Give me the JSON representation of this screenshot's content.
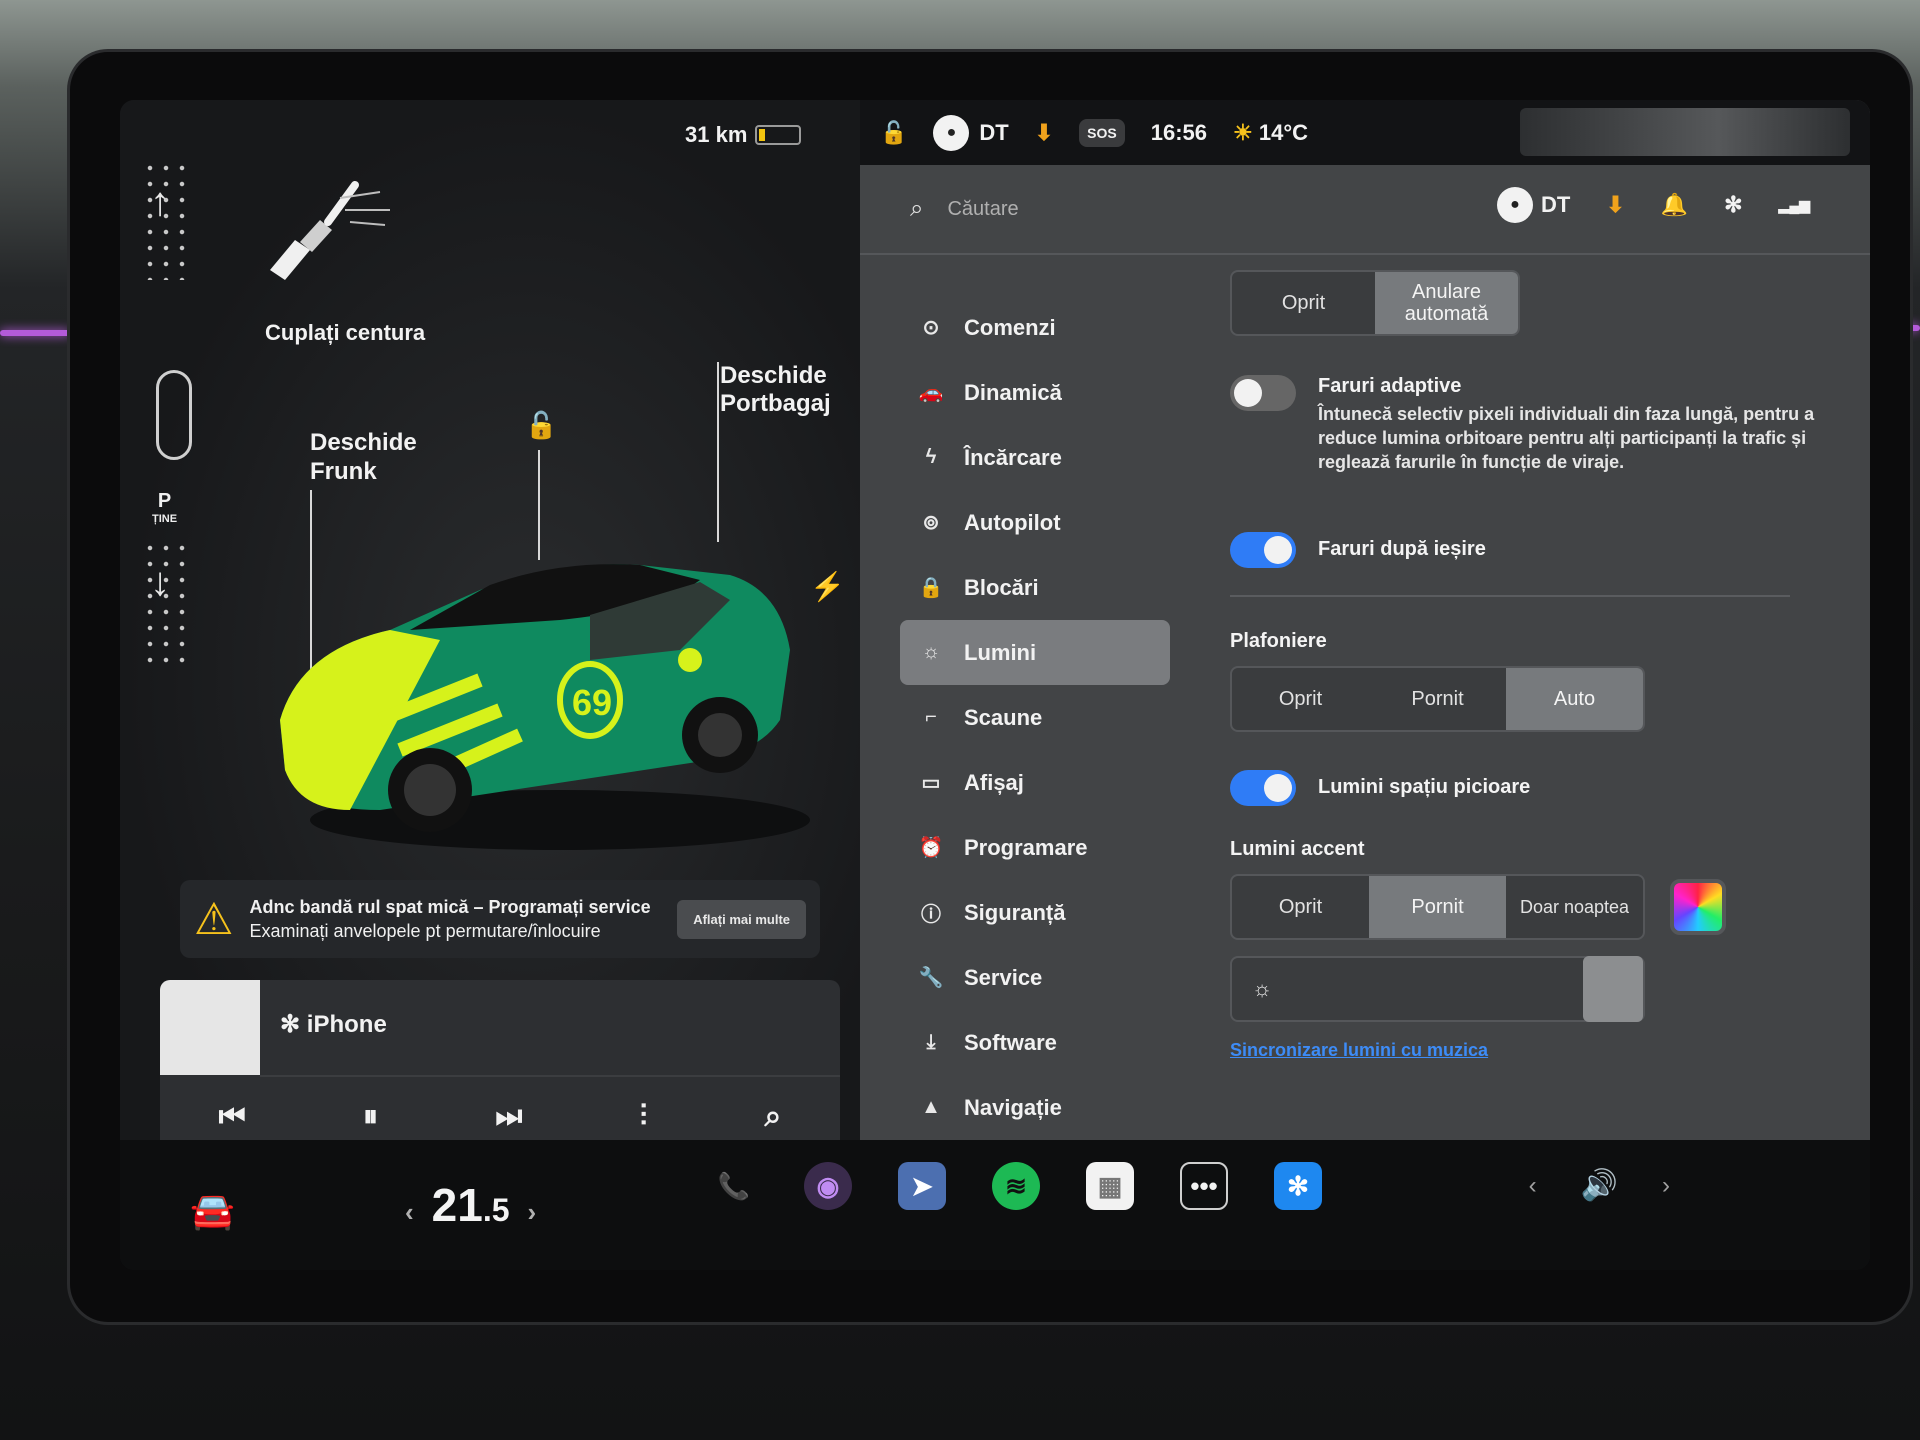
{
  "status": {
    "range": "31 km",
    "user": "DT",
    "sos": "SOS",
    "time": "16:56",
    "temperature": "14°C"
  },
  "left_panel": {
    "seatbelt_warning": "Cuplați centura",
    "frunk_label_1": "Deschide",
    "frunk_label_2": "Frunk",
    "trunk_label_1": "Deschide",
    "trunk_label_2": "Portbagaj",
    "gear": "P",
    "gear_sub": "ȚINE",
    "car_number": "69"
  },
  "alert": {
    "line1": "Adnc bandă rul spat mică – Programați service",
    "line2": "Examinați anvelopele pt permutare/înlocuire",
    "button": "Aflați mai multe"
  },
  "media": {
    "source": "iPhone",
    "dots": "• • •"
  },
  "search": {
    "placeholder": "Căutare",
    "user": "DT"
  },
  "menu": {
    "items": [
      {
        "label": "Comenzi",
        "icon": "toggle-icon"
      },
      {
        "label": "Dinamică",
        "icon": "car-icon"
      },
      {
        "label": "Încărcare",
        "icon": "bolt-icon"
      },
      {
        "label": "Autopilot",
        "icon": "steering-wheel-icon"
      },
      {
        "label": "Blocări",
        "icon": "lock-icon"
      },
      {
        "label": "Lumini",
        "icon": "sun-icon",
        "active": true
      },
      {
        "label": "Scaune",
        "icon": "seat-icon"
      },
      {
        "label": "Afișaj",
        "icon": "display-icon"
      },
      {
        "label": "Programare",
        "icon": "alarm-icon"
      },
      {
        "label": "Siguranță",
        "icon": "info-circle-icon"
      },
      {
        "label": "Service",
        "icon": "wrench-icon"
      },
      {
        "label": "Software",
        "icon": "download-icon"
      },
      {
        "label": "Navigație",
        "icon": "navigation-icon"
      }
    ]
  },
  "lights": {
    "headlight_off": "Oprit",
    "headlight_auto_1": "Anulare",
    "headlight_auto_2": "automată",
    "adaptive_title": "Faruri adaptive",
    "adaptive_desc": "Întunecă selectiv pixeli individuali din faza lungă, pentru a reduce lumina orbitoare pentru alți participanți la trafic și reglează farurile în funcție de viraje.",
    "adaptive_on": false,
    "exit_title": "Faruri după ieșire",
    "exit_on": true,
    "dome_head": "Plafoniere",
    "dome_off": "Oprit",
    "dome_on": "Pornit",
    "dome_auto": "Auto",
    "footwell_title": "Lumini spațiu picioare",
    "footwell_on": true,
    "accent_head": "Lumini accent",
    "accent_off": "Oprit",
    "accent_on": "Pornit",
    "accent_night": "Doar noaptea",
    "brightness": 1.0,
    "sync_link": "Sincronizare lumini cu muzica"
  },
  "dock": {
    "temp_whole": "21",
    "temp_dec": ".5"
  },
  "colors": {
    "accent_blue": "#2f7cf6",
    "link_blue": "#3d8cf7",
    "warning_yellow": "#f6c21c",
    "car_green": "#0f8a5f",
    "car_yellow": "#d6f21b"
  }
}
